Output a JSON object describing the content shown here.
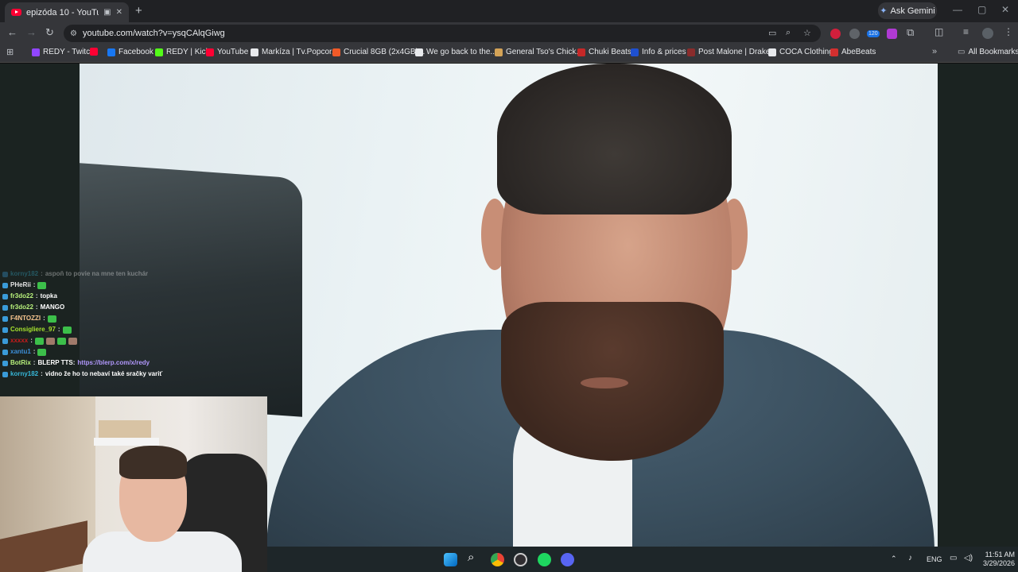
{
  "browser": {
    "tab": {
      "title": "epizóda 10 - YouTube"
    },
    "new_tab": "+",
    "ask_gemini": "Ask Gemini",
    "window_controls": {
      "minimize": "—",
      "maximize": "▢",
      "close": "✕"
    },
    "url": "youtube.com/watch?v=ysqCAlqGiwg",
    "extension_badge": "120",
    "bookmarks": [
      {
        "label": "REDY - Twitch",
        "icon": "twitch-icon",
        "color": "#9146ff"
      },
      {
        "label": "",
        "icon": "youtube-icon",
        "color": "#ff0033"
      },
      {
        "label": "Facebook",
        "icon": "facebook-icon",
        "color": "#1877f2"
      },
      {
        "label": "REDY | Kick",
        "icon": "kick-icon",
        "color": "#53fc18"
      },
      {
        "label": "YouTube",
        "icon": "youtube-icon",
        "color": "#ff0033"
      },
      {
        "label": "Markíza | Tv.Popcor...",
        "icon": "globe-icon",
        "color": "#e8eaed"
      },
      {
        "label": "Crucial 8GB (2x4GB)...",
        "icon": "crucial-icon",
        "color": "#f05a28"
      },
      {
        "label": "We go back to the...",
        "icon": "google-icon",
        "color": "#e8eaed"
      },
      {
        "label": "General Tso's Chick...",
        "icon": "food-icon",
        "color": "#d4a357"
      },
      {
        "label": "Chuki Beats",
        "icon": "beats-icon",
        "color": "#c62828"
      },
      {
        "label": "Info & prices",
        "icon": "b-icon",
        "color": "#1e50d0"
      },
      {
        "label": "Post Malone | Drake...",
        "icon": "music-icon",
        "color": "#8a2c2c"
      },
      {
        "label": "COCA Clothing",
        "icon": "coca-icon",
        "color": "#e8eaed"
      },
      {
        "label": "AbeBeats",
        "icon": "abebeats-icon",
        "color": "#d32f2f"
      }
    ],
    "more_bookmarks": "»",
    "all_bookmarks": "All Bookmarks"
  },
  "chat": [
    {
      "user": "korny182",
      "user_color": "#36b7d8",
      "message": "aspoň to povie na mne ten kuchár",
      "faded": true,
      "link": ""
    },
    {
      "user": "PHeRii",
      "user_color": "#e7e7e7",
      "message": "",
      "emotes": 1,
      "link": ""
    },
    {
      "user": "fr3do22",
      "user_color": "#b9f27c",
      "message": "topka",
      "link": ""
    },
    {
      "user": "fr3do22",
      "user_color": "#b9f27c",
      "message": "MANGO",
      "link": ""
    },
    {
      "user": "F4NTOZZI",
      "user_color": "#f7c58f",
      "message": "",
      "emotes": 1,
      "link": ""
    },
    {
      "user": "Consigliere_97",
      "user_color": "#a6e22e",
      "message": "",
      "emotes": 1,
      "link": ""
    },
    {
      "user": "xxxxx",
      "user_color": "#c81b1b",
      "message": "",
      "emotes": 4,
      "link": ""
    },
    {
      "user": "xantu1",
      "user_color": "#3c8ed8",
      "message": "",
      "emotes": 1,
      "link": ""
    },
    {
      "user": "BotRix",
      "user_color": "#b9f27c",
      "message": "BLERP TTS: ",
      "link": "https://blerp.com/x/redy"
    },
    {
      "user": "korny182",
      "user_color": "#36b7d8",
      "message": "vidno že ho to nebaví také sračky variť",
      "link": ""
    }
  ],
  "taskbar": {
    "apps": [
      "windows-start-icon",
      "search-icon",
      "chrome-icon",
      "obs-icon",
      "spotify-icon",
      "discord-icon"
    ],
    "tray_lang": "ENG",
    "time": "11:51 AM",
    "date": "3/29/2026"
  }
}
